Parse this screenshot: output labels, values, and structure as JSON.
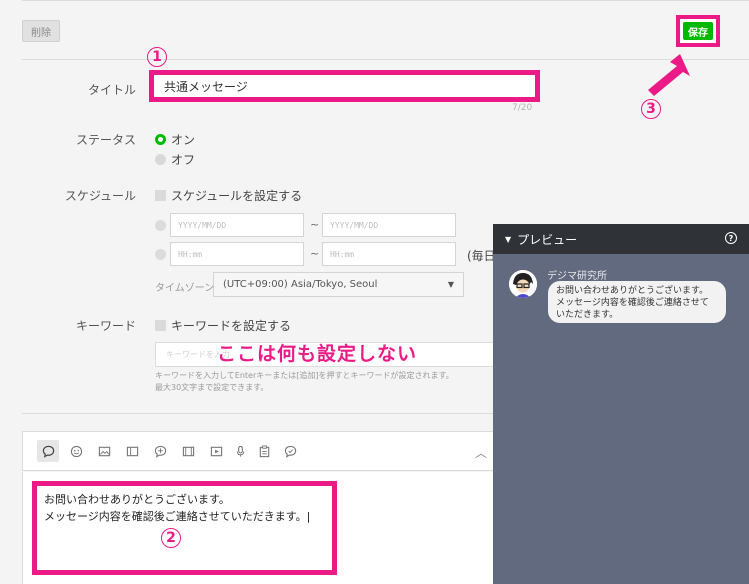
{
  "toolbar": {
    "delete_label": "削除",
    "save_label": "保存"
  },
  "form": {
    "title_label": "タイトル",
    "title_value": "共通メッセージ",
    "title_counter": "7/20",
    "status_label": "ステータス",
    "status_on": "オン",
    "status_off": "オフ",
    "schedule_label": "スケジュール",
    "schedule_checkbox": "スケジュールを設定する",
    "date_placeholder": "YYYY/MM/DD",
    "time_placeholder": "HH:mm",
    "tilde": "~",
    "every_day": "(毎日)",
    "timezone_label": "タイムゾーン",
    "timezone_value": "(UTC+09:00) Asia/Tokyo, Seoul",
    "keyword_label": "キーワード",
    "keyword_checkbox": "キーワードを設定する",
    "keyword_placeholder": "キーワードを入力",
    "keyword_help_1": "キーワードを入力してEnterキーまたは[追加]を押すとキーワードが設定されます。",
    "keyword_help_2": "最大30文字まで設定できます。"
  },
  "annotations": {
    "note": "ここは何も設定しない",
    "n1": "1",
    "n2": "2",
    "n3": "3",
    "accent_color": "#ec1a87"
  },
  "editor": {
    "line1": "お問い合わせありがとうございます。",
    "line2": "メッセージ内容を確認後ご連絡させていただきます。|"
  },
  "preview": {
    "title": "プレビュー",
    "sender": "デジマ研究所",
    "bubble_line1": "お問い合わせありがとうございます。",
    "bubble_line2": "メッセージ内容を確認後ご連絡させて",
    "bubble_line3": "いただきます。"
  },
  "colors": {
    "line_green": "#00b900",
    "preview_bg": "#626a80",
    "preview_header": "#2f3236"
  }
}
